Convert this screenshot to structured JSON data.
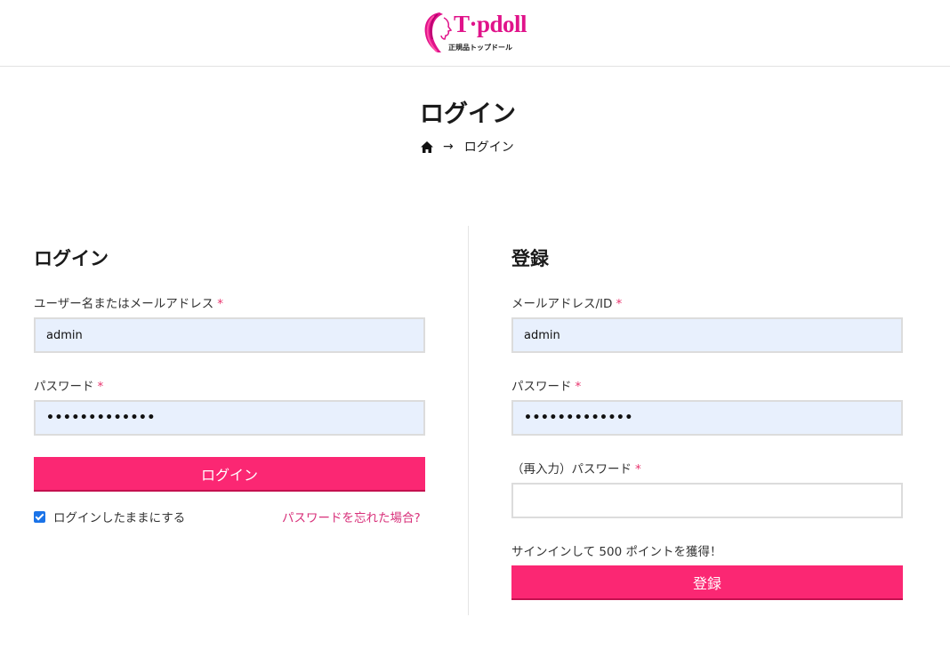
{
  "header": {
    "logo_text": "T·pdoll",
    "logo_sub": "正規品トップドール"
  },
  "page": {
    "title": "ログイン",
    "breadcrumb": {
      "arrow": "→",
      "current": "ログイン"
    }
  },
  "login": {
    "title": "ログイン",
    "username_label": "ユーザー名またはメールアドレス",
    "username_value": "admin",
    "password_label": "パスワード",
    "password_value": "•••••••••••••",
    "submit_label": "ログイン",
    "remember_label": "ログインしたままにする",
    "forgot_label": "パスワードを忘れた場合?"
  },
  "register": {
    "title": "登録",
    "email_label": "メールアドレス/ID",
    "email_value": "admin",
    "password_label": "パスワード",
    "password_value": "•••••••••••••",
    "confirm_label": "（再入力）パスワード",
    "confirm_value": "",
    "promo_text": "サインインして 500 ポイントを獲得！",
    "submit_label": "登録"
  },
  "required_mark": "*",
  "colors": {
    "accent": "#fb2773",
    "brand": "#e0138a",
    "link": "#d8307a",
    "input_filled": "#e8f0fd"
  }
}
